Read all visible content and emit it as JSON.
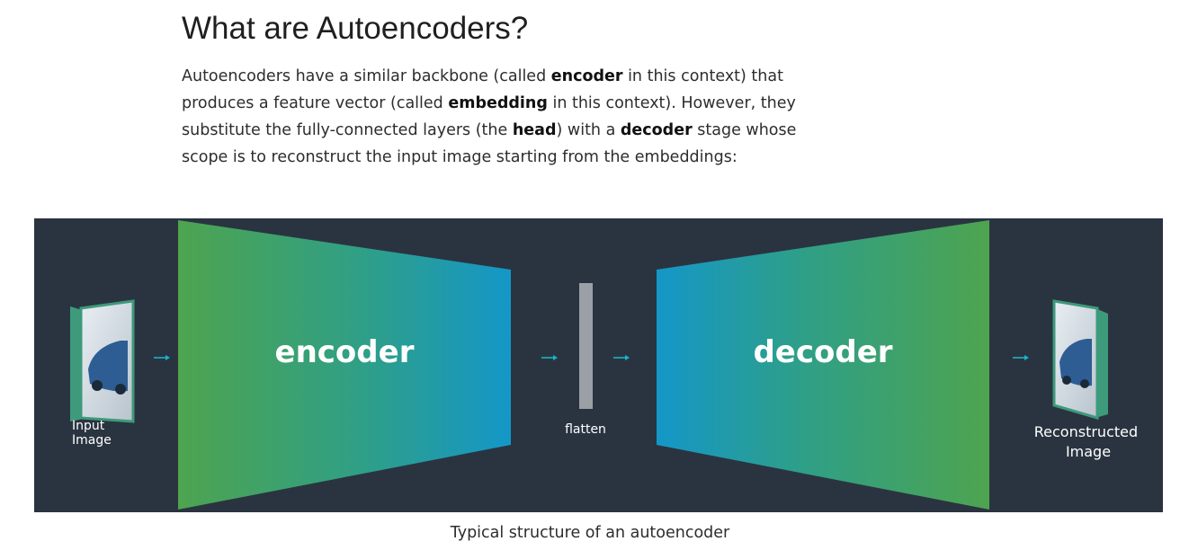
{
  "article": {
    "title": "What are Autoencoders?",
    "paragraph": [
      {
        "text": "Autoencoders have a similar backbone (called ",
        "bold": false
      },
      {
        "text": "encoder",
        "bold": true
      },
      {
        "text": " in this context) that produces a feature vector (called ",
        "bold": false
      },
      {
        "text": "embedding",
        "bold": true
      },
      {
        "text": " in this context). However, they substitute the fully-connected layers (the ",
        "bold": false
      },
      {
        "text": "head",
        "bold": true
      },
      {
        "text": ") with a ",
        "bold": false
      },
      {
        "text": "decoder",
        "bold": true
      },
      {
        "text": " stage whose scope is to reconstruct the input image starting from the embeddings:",
        "bold": false
      }
    ]
  },
  "diagram": {
    "input_label": [
      "Input",
      "Image"
    ],
    "encoder_label": "encoder",
    "flatten_label": "flatten",
    "decoder_label": "decoder",
    "output_label": [
      "Reconstructed",
      "Image"
    ],
    "colors": {
      "background": "#2a3440",
      "gradient_green": "#4ea44f",
      "gradient_blue": "#1497c8",
      "arrow": "#19b3c8",
      "flatten_bar": "#9aa0a6"
    }
  },
  "caption": "Typical structure of an autoencoder"
}
